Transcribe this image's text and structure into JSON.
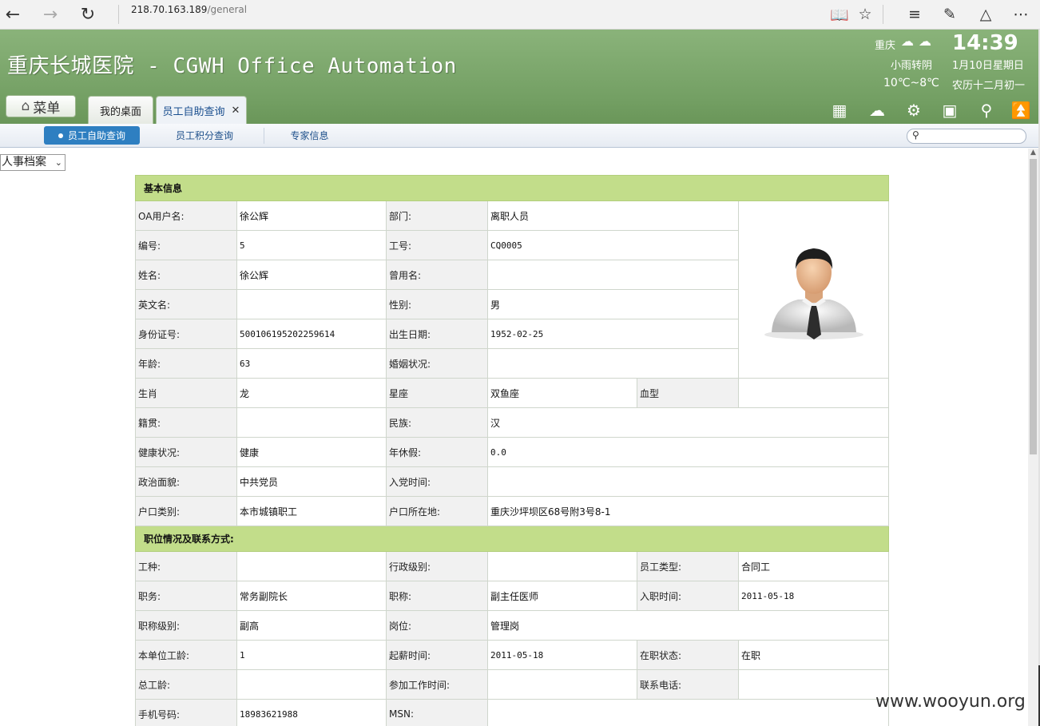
{
  "browser": {
    "address_host": "218.70.163.189",
    "address_path": "/general"
  },
  "header": {
    "title": "重庆长城医院 - CGWH Office Automation",
    "weather_city": "重庆",
    "weather_desc": "小雨转阴",
    "weather_temp": "10℃~8℃",
    "clock": "14:39",
    "date": "1月10日星期日",
    "lunar": "农历十二月初一",
    "menu_label": "菜单",
    "tabs": [
      {
        "label": "我的桌面"
      },
      {
        "label": "员工自助查询"
      }
    ]
  },
  "subnav": {
    "items": [
      {
        "label": "员工自助查询"
      },
      {
        "label": "员工积分查询"
      },
      {
        "label": "专家信息"
      }
    ],
    "search_placeholder": ""
  },
  "content": {
    "select_value": "人事档案",
    "section_basic": "基本信息",
    "section_position": "职位情况及联系方式:",
    "basic": {
      "oa_user_label": "OA用户名:",
      "oa_user": "徐公辉",
      "dept_label": "部门:",
      "dept": "离职人员",
      "no_label": "编号:",
      "no": "5",
      "work_no_label": "工号:",
      "work_no": "CQ0005",
      "name_label": "姓名:",
      "name": "徐公辉",
      "former_name_label": "曾用名:",
      "former_name": "",
      "english_name_label": "英文名:",
      "english_name": "",
      "gender_label": "性别:",
      "gender": "男",
      "id_label": "身份证号:",
      "id": "500106195202259614",
      "birth_label": "出生日期:",
      "birth": "1952-02-25",
      "age_label": "年龄:",
      "age": "63",
      "marital_label": "婚姻状况:",
      "marital": "",
      "zodiac_label": "生肖",
      "zodiac": "龙",
      "constellation_label": "星座",
      "constellation": "双鱼座",
      "blood_label": "血型",
      "blood": "",
      "native_label": "籍贯:",
      "native": "",
      "ethnic_label": "民族:",
      "ethnic": "汉",
      "health_label": "健康状况:",
      "health": "健康",
      "leave_label": "年休假:",
      "leave": "0.0",
      "political_label": "政治面貌:",
      "political": "中共党员",
      "party_date_label": "入党时间:",
      "party_date": "",
      "hukou_type_label": "户口类别:",
      "hukou_type": "本市城镇职工",
      "hukou_addr_label": "户口所在地:",
      "hukou_addr": "重庆沙坪坝区68号附3号8-1"
    },
    "position": {
      "job_type_label": "工种:",
      "job_type": "",
      "admin_level_label": "行政级别:",
      "admin_level": "",
      "emp_type_label": "员工类型:",
      "emp_type": "合同工",
      "duty_label": "职务:",
      "duty": "常务副院长",
      "title_label": "职称:",
      "title": "副主任医师",
      "hire_date_label": "入职时间:",
      "hire_date": "2011-05-18",
      "title_level_label": "职称级别:",
      "title_level": "副高",
      "post_label": "岗位:",
      "post": "管理岗",
      "unit_years_label": "本单位工龄:",
      "unit_years": "1",
      "salary_date_label": "起薪时间:",
      "salary_date": "2011-05-18",
      "status_label": "在职状态:",
      "status": "在职",
      "total_years_label": "总工龄:",
      "total_years": "",
      "work_start_label": "参加工作时间:",
      "work_start": "",
      "phone_label": "联系电话:",
      "phone": "",
      "mobile_label": "手机号码:",
      "mobile": "18983621988",
      "msn_label": "MSN:",
      "msn": ""
    }
  },
  "watermark": "www.wooyun.org",
  "colors": {
    "header_green": "#739f63",
    "section_green": "#c2dd8a",
    "subtab_active": "#2e7fc1"
  }
}
